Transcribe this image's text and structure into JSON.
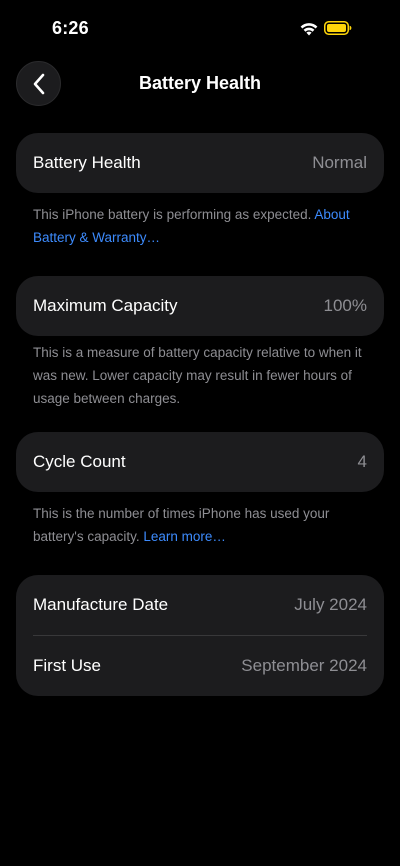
{
  "status_bar": {
    "time": "6:26",
    "wifi_icon": "wifi-icon",
    "battery_icon": "battery-icon",
    "battery_color": "#ffd60a"
  },
  "nav": {
    "back_icon": "chevron-left-icon",
    "title": "Battery Health"
  },
  "battery_health": {
    "label": "Battery Health",
    "value": "Normal",
    "note": "This iPhone battery is performing as expected. ",
    "note_link": "About Battery & Warranty…"
  },
  "maximum_capacity": {
    "label": "Maximum Capacity",
    "value": "100%",
    "note": "This is a measure of battery capacity relative to when it was new. Lower capacity may result in fewer hours of usage between charges."
  },
  "cycle_count": {
    "label": "Cycle Count",
    "value": "4",
    "note": "This is the number of times iPhone has used your battery's capacity. ",
    "note_link": "Learn more…"
  },
  "dates": {
    "manufacture_label": "Manufacture Date",
    "manufacture_value": "July 2024",
    "first_use_label": "First Use",
    "first_use_value": "September 2024"
  },
  "colors": {
    "background": "#000000",
    "card": "#1c1c1e",
    "secondary_text": "#8e8e93",
    "link": "#3d8bfd"
  }
}
